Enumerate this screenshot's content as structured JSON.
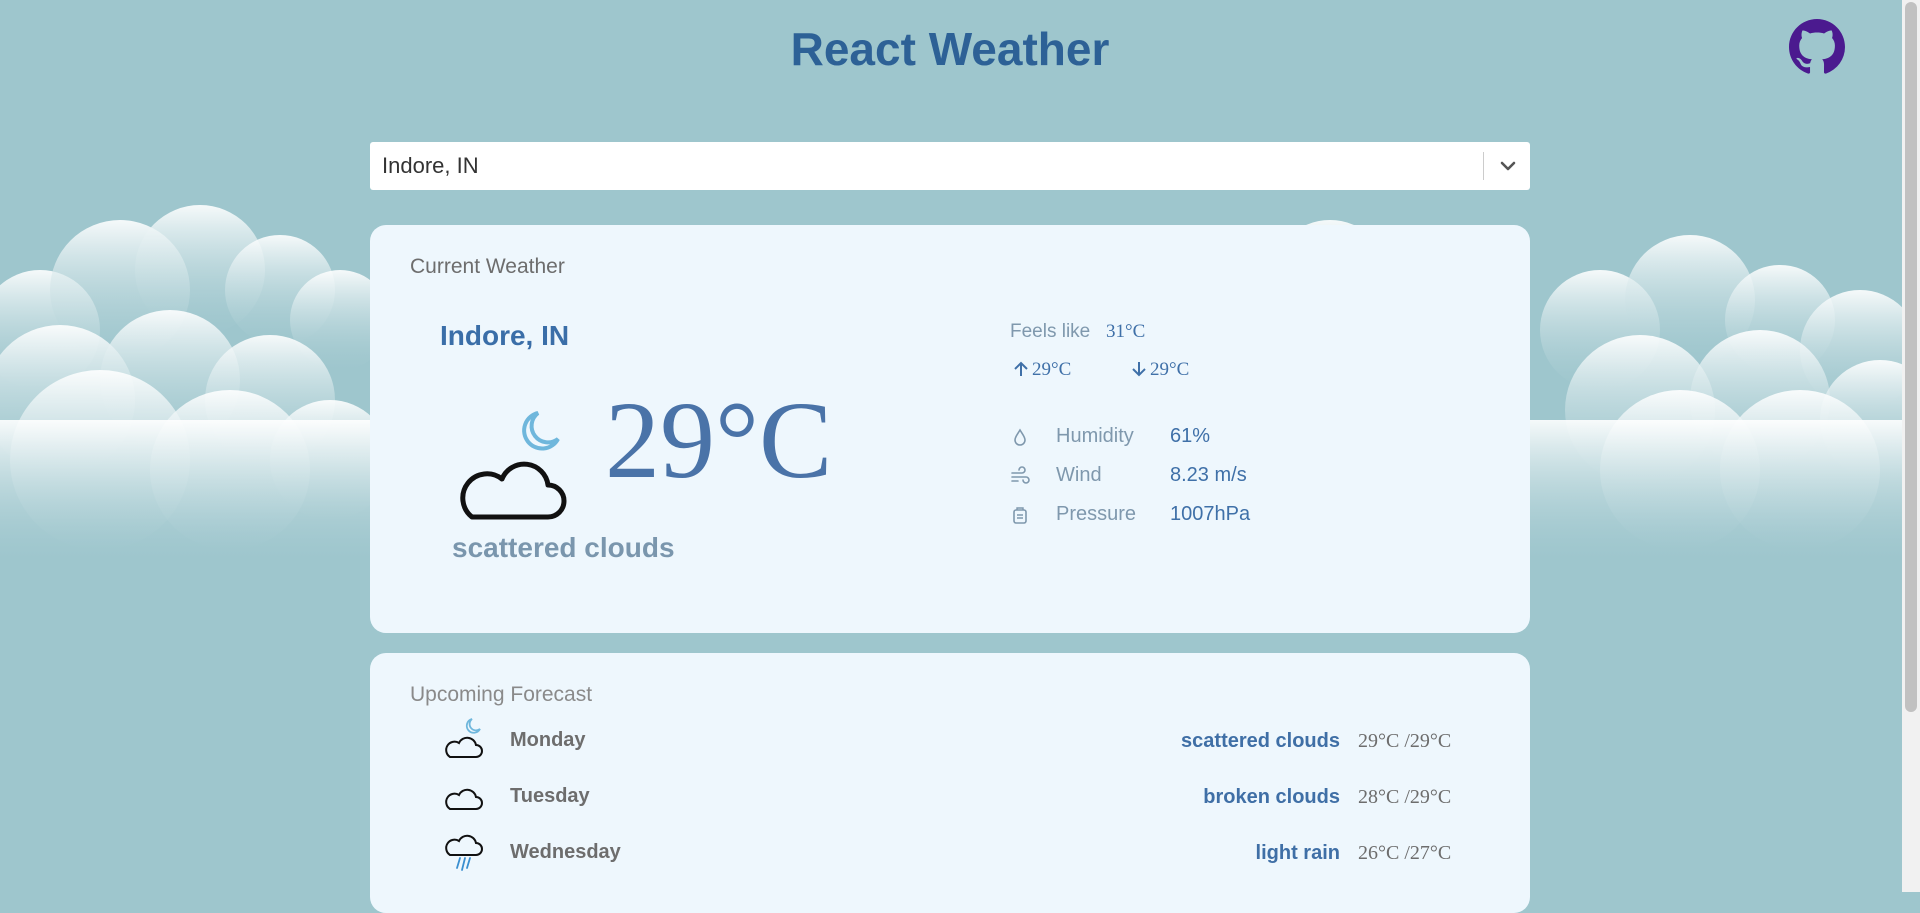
{
  "header": {
    "title": "React Weather",
    "github_icon": "github-icon"
  },
  "search": {
    "value": "Indore, IN",
    "chevron_icon": "chevron-down-icon"
  },
  "current": {
    "heading": "Current Weather",
    "city": "Indore, IN",
    "temperature": "29°C",
    "description": "scattered clouds",
    "icon": "cloud-moon-icon",
    "feels_like_label": "Feels like",
    "feels_like_value": "31°C",
    "max_temp": "29°C",
    "min_temp": "29°C",
    "details": [
      {
        "label": "Humidity",
        "value": "61%",
        "icon": "humidity-icon"
      },
      {
        "label": "Wind",
        "value": "8.23 m/s",
        "icon": "wind-icon"
      },
      {
        "label": "Pressure",
        "value": "1007hPa",
        "icon": "pressure-icon"
      }
    ]
  },
  "forecast": {
    "heading": "Upcoming Forecast",
    "days": [
      {
        "day": "Monday",
        "description": "scattered clouds",
        "temps": "29°C /29°C",
        "icon": "cloud-moon-icon"
      },
      {
        "day": "Tuesday",
        "description": "broken clouds",
        "temps": "28°C /29°C",
        "icon": "cloud-icon"
      },
      {
        "day": "Wednesday",
        "description": "light rain",
        "temps": "26°C /27°C",
        "icon": "rain-cloud-icon"
      }
    ]
  },
  "colors": {
    "background": "#9ec6cd",
    "card": "#eef7fd",
    "title": "#2d6196",
    "accent": "#3f70a8",
    "github": "#4b1a8f"
  }
}
